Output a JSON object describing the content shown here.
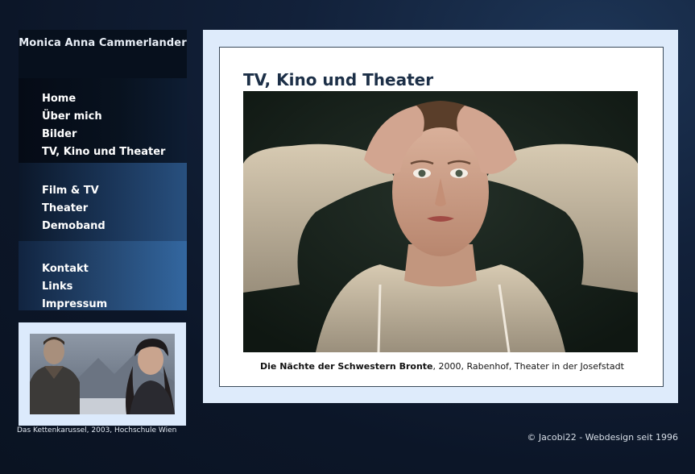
{
  "site": {
    "title": "Monica Anna Cammerlander"
  },
  "nav": {
    "group1": [
      {
        "label": "Home"
      },
      {
        "label": "Über mich"
      },
      {
        "label": "Bilder"
      },
      {
        "label": "TV, Kino und Theater"
      }
    ],
    "group2": [
      {
        "label": "Film & TV"
      },
      {
        "label": "Theater"
      },
      {
        "label": "Demoband"
      }
    ],
    "group3": [
      {
        "label": "Kontakt"
      },
      {
        "label": "Links"
      },
      {
        "label": "Impressum"
      }
    ]
  },
  "thumbnail": {
    "caption": "Das Kettenkarussel, 2003, Hochschule Wien"
  },
  "main": {
    "title": "TV, Kino und Theater",
    "caption_bold": "Die Nächte der Schwestern Bronte",
    "caption_rest": ", 2000, Rabenhof, Theater in der Josefstadt"
  },
  "footer": {
    "text": "© Jacobi22 - Webdesign seit 1996"
  }
}
